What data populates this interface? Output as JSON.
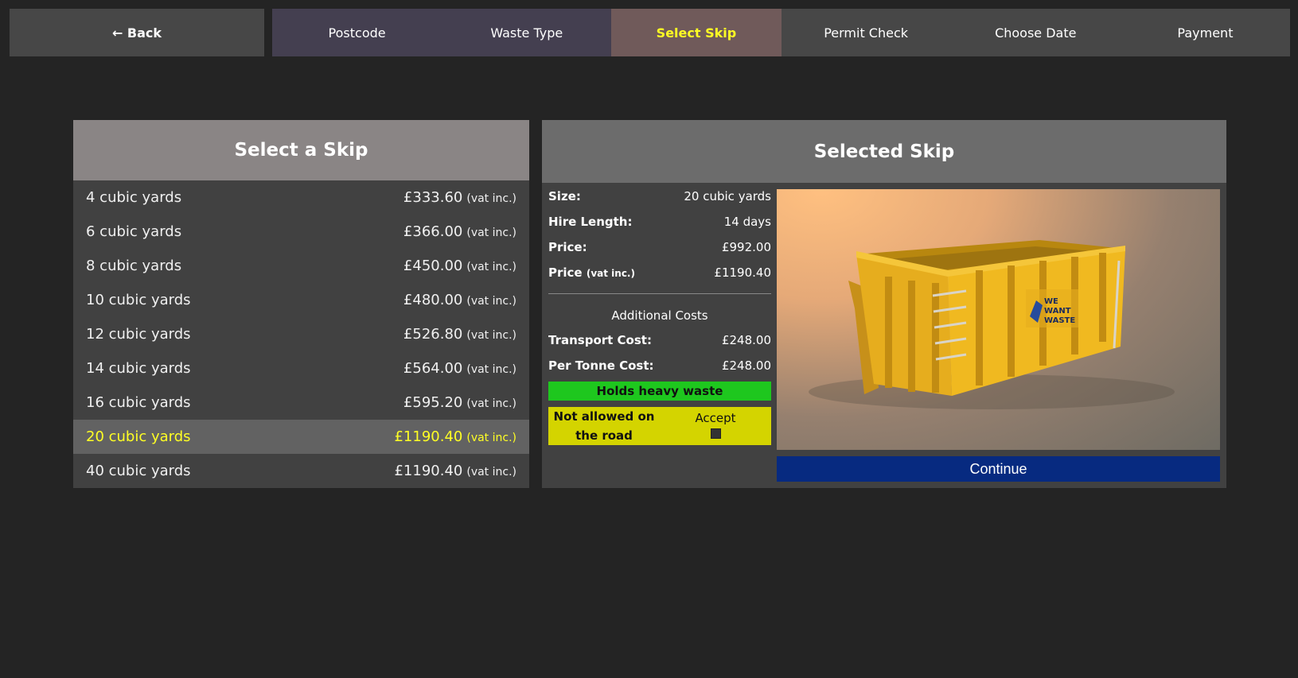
{
  "nav": {
    "back_label": "← Back",
    "steps": [
      "Postcode",
      "Waste Type",
      "Select Skip",
      "Permit Check",
      "Choose Date",
      "Payment"
    ]
  },
  "list": {
    "title": "Select a Skip",
    "vat_note": "(vat inc.)",
    "items": [
      {
        "size": "4 cubic yards",
        "price": "£333.60"
      },
      {
        "size": "6 cubic yards",
        "price": "£366.00"
      },
      {
        "size": "8 cubic yards",
        "price": "£450.00"
      },
      {
        "size": "10 cubic yards",
        "price": "£480.00"
      },
      {
        "size": "12 cubic yards",
        "price": "£526.80"
      },
      {
        "size": "14 cubic yards",
        "price": "£564.00"
      },
      {
        "size": "16 cubic yards",
        "price": "£595.20"
      },
      {
        "size": "20 cubic yards",
        "price": "£1190.40"
      },
      {
        "size": "40 cubic yards",
        "price": "£1190.40"
      }
    ]
  },
  "selected": {
    "title": "Selected Skip",
    "size_label": "Size:",
    "size_value": "20 cubic yards",
    "hire_label": "Hire Length:",
    "hire_value": "14 days",
    "price_label": "Price:",
    "price_value": "£992.00",
    "price_vat_label": "Price",
    "price_vat_small": "(vat inc.)",
    "price_vat_value": "£1190.40",
    "additional_title": "Additional Costs",
    "transport_label": "Transport Cost:",
    "transport_value": "£248.00",
    "tonne_label": "Per Tonne Cost:",
    "tonne_value": "£248.00",
    "heavy_badge": "Holds heavy waste",
    "road_warning": "Not allowed on the road",
    "accept_label": "Accept",
    "continue_label": "Continue",
    "logo_text": [
      "WE",
      "WANT",
      "WASTE"
    ]
  },
  "colors": {
    "background": "#242424",
    "active_step_text": "#ffff24",
    "heavy_badge": "#1ec71e",
    "road_warning": "#d4d400",
    "continue_button": "#072a80",
    "skip_yellow": "#e8b21e"
  }
}
